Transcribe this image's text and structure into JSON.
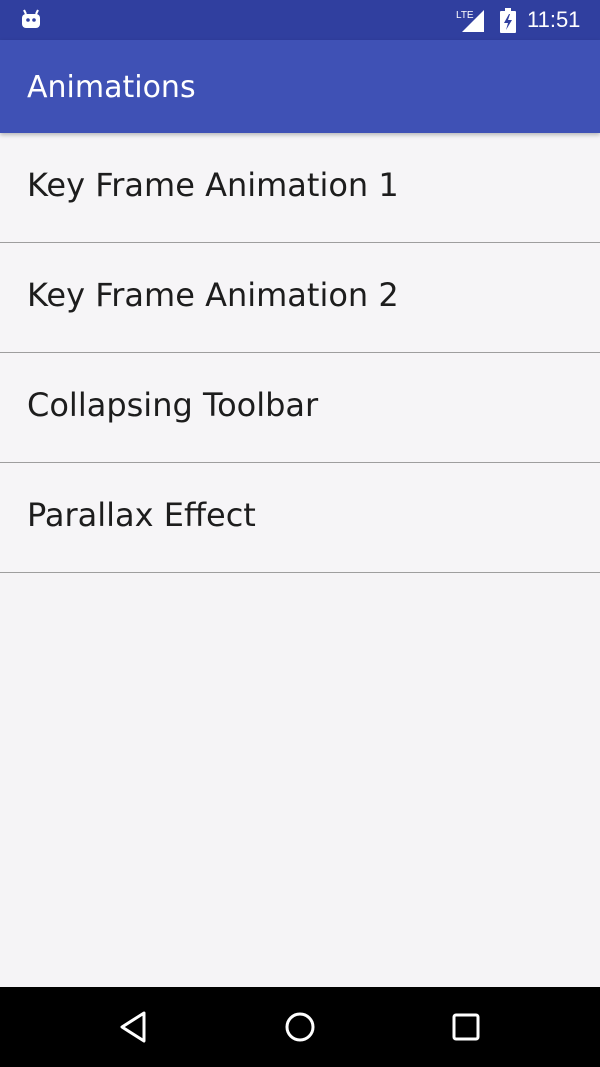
{
  "status_bar": {
    "time": "11:51",
    "network": "LTE",
    "icons": [
      "android-robot-icon",
      "lte-signal-icon",
      "battery-charging-icon"
    ]
  },
  "app_bar": {
    "title": "Animations",
    "color": "#3f51b5"
  },
  "list": {
    "items": [
      {
        "label": "Key Frame Animation 1"
      },
      {
        "label": "Key Frame Animation 2"
      },
      {
        "label": "Collapsing Toolbar"
      },
      {
        "label": "Parallax Effect"
      }
    ]
  },
  "nav_bar": {
    "icons": [
      "back-icon",
      "home-icon",
      "recents-icon"
    ]
  }
}
